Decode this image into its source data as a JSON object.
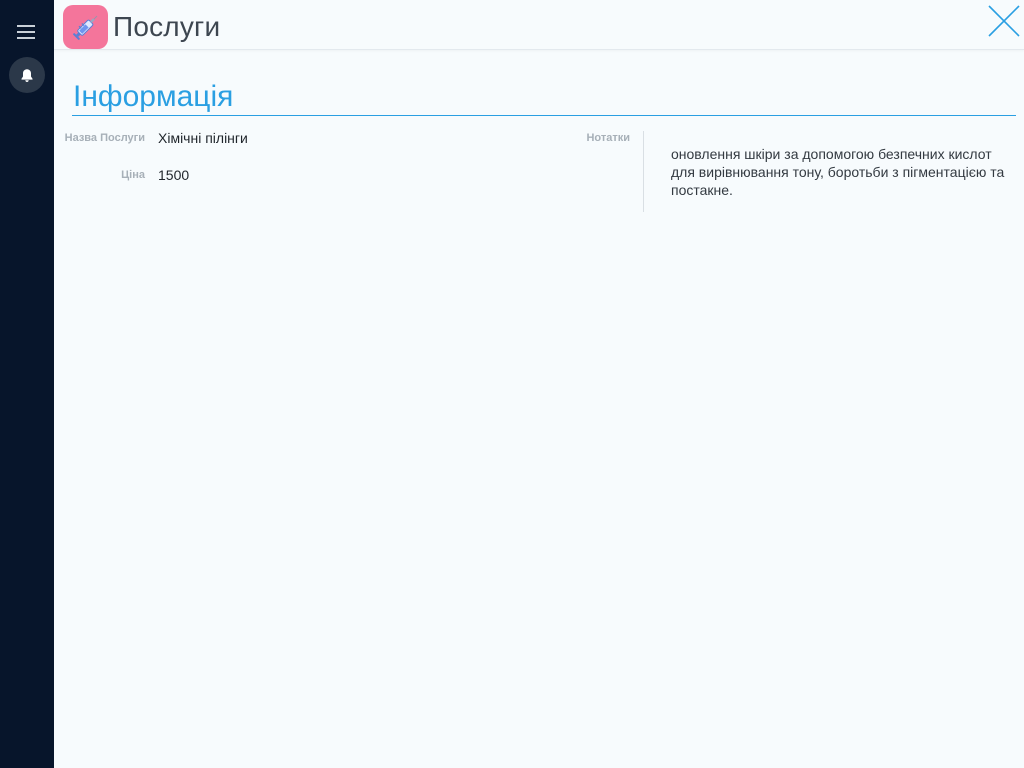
{
  "header": {
    "title": "Послуги",
    "app_icon": "syringe-icon",
    "close_icon": "close-icon"
  },
  "sidebar": {
    "menu_icon": "hamburger-menu-icon",
    "notifications_icon": "bell-icon"
  },
  "section": {
    "title": "Інформація"
  },
  "fields": {
    "name_label": "Назва Послуги",
    "name_value": "Хімічні пілінги",
    "price_label": "Ціна",
    "price_value": "1500",
    "notes_label": "Нотатки",
    "notes_value": "оновлення шкіри за допомогою безпечних кислот для вирівнювання тону, боротьби з пігментацією та постакне."
  },
  "colors": {
    "sidebar_bg": "#07152b",
    "accent": "#2a9fe2",
    "app_icon_bg": "#f4759b",
    "page_bg": "#f7fbfd"
  }
}
